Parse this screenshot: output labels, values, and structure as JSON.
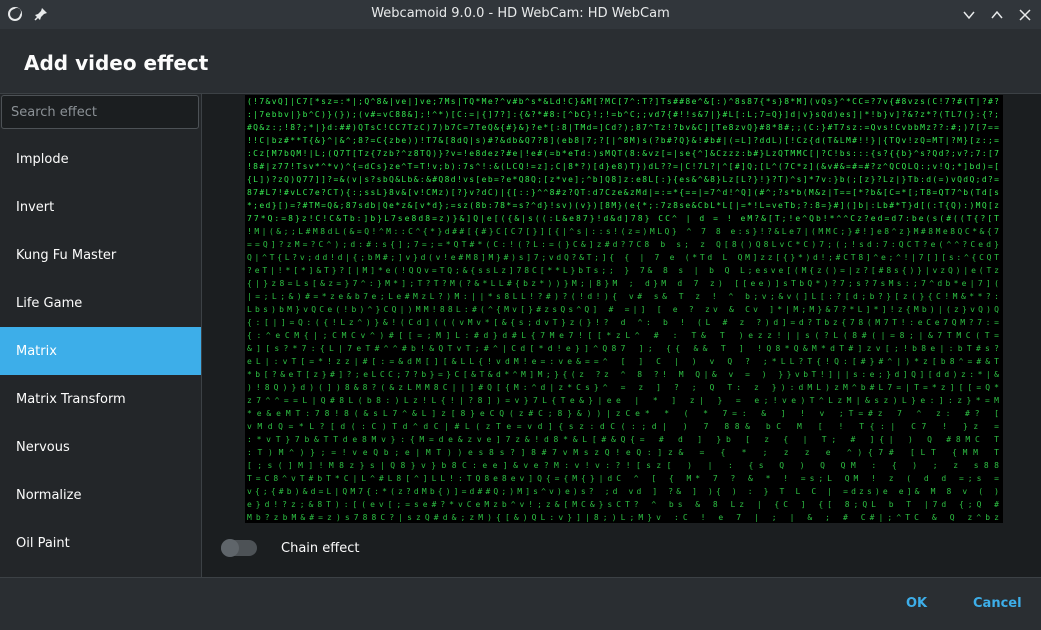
{
  "window": {
    "title": "Webcamoid 9.0.0 - HD WebCam: HD WebCam",
    "icons": [
      "app-icon",
      "pin-icon",
      "chevron-down-icon",
      "chevron-up-icon",
      "close-icon"
    ]
  },
  "dialog": {
    "title": "Add video effect"
  },
  "search": {
    "placeholder": "Search effect",
    "value": ""
  },
  "effects": [
    {
      "label": "Implode",
      "selected": false
    },
    {
      "label": "Invert",
      "selected": false
    },
    {
      "label": "Kung Fu Master",
      "selected": false
    },
    {
      "label": "Life Game",
      "selected": false
    },
    {
      "label": "Matrix",
      "selected": true
    },
    {
      "label": "Matrix Transform",
      "selected": false
    },
    {
      "label": "Nervous",
      "selected": false
    },
    {
      "label": "Normalize",
      "selected": false
    },
    {
      "label": "Oil Paint",
      "selected": false
    }
  ],
  "chain": {
    "label": "Chain effect",
    "enabled": false
  },
  "footer": {
    "ok_label": "OK",
    "cancel_label": "Cancel"
  },
  "colors": {
    "accent": "#3daee9",
    "matrix_green": "#3cff5a",
    "background": "#2a2e32"
  }
}
